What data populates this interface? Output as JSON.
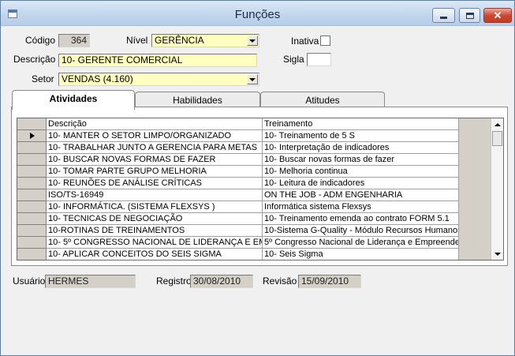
{
  "window": {
    "title": "Funções"
  },
  "header": {
    "codigo_label": "Código",
    "codigo_value": "364",
    "nivel_label": "Nível",
    "nivel_value": "GERÊNCIA",
    "inativa_label": "Inativa",
    "inativa_checked": false,
    "descricao_label": "Descrição",
    "descricao_value": "10- GERENTE COMERCIAL",
    "sigla_label": "Sigla",
    "sigla_value": "",
    "setor_label": "Setor",
    "setor_value": "VENDAS (4.160)"
  },
  "tabs": [
    {
      "label": "Atividades",
      "active": true
    },
    {
      "label": "Habilidades",
      "active": false
    },
    {
      "label": "Atitudes",
      "active": false
    }
  ],
  "grid": {
    "columns": [
      "Descrição",
      "Treinamento"
    ],
    "rows": [
      [
        "10- MANTER O SETOR LIMPO/ORGANIZADO",
        "10- Treinamento de 5 S"
      ],
      [
        "10- TRABALHAR JUNTO A GERENCIA PARA METAS",
        "10- Interpretação de indicadores"
      ],
      [
        "10- BUSCAR NOVAS FORMAS DE FAZER",
        "10- Buscar novas formas de fazer"
      ],
      [
        "10- TOMAR PARTE GRUPO MELHORIA",
        "10- Melhoria continua"
      ],
      [
        "10-  REUNÕES DE ANÁLISE CRÍTICAS",
        "10- Leitura de indicadores"
      ],
      [
        "ISO/TS-16949",
        "ON THE JOB - ADM ENGENHARIA"
      ],
      [
        "10- INFORMÁTICA. (SISTEMA FLEXSYS )",
        "Informática sistema Flexsys"
      ],
      [
        "10- TECNICAS DE NEGOCIAÇÃO",
        "10- Treinamento emenda ao contrato  FORM 5.1"
      ],
      [
        "10-ROTINAS DE TREINAMENTOS",
        "10-Sistema G-Quality - Módulo Recursos Humanos"
      ],
      [
        "10- 5º CONGRESSO NACIONAL DE LIDERANÇA E EMI",
        "5º Congresso Nacional de Liderança e Empreendec"
      ],
      [
        "10- APLICAR CONCEITOS DO SEIS SIGMA",
        "10- Seis Sigma"
      ]
    ],
    "selected_row": 0
  },
  "footer": {
    "usuario_label": "Usuário",
    "usuario_value": "HERMES",
    "registro_label": "Registro",
    "registro_value": "30/08/2010",
    "revisao_label": "Revisão",
    "revisao_value": "15/09/2010"
  }
}
